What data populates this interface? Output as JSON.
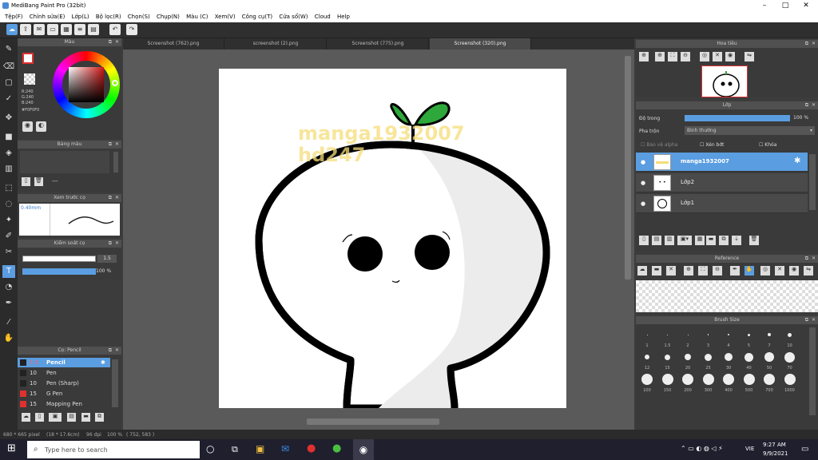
{
  "window": {
    "title": "MediBang Paint Pro (32bit)"
  },
  "menu": [
    "Tệp(F)",
    "Chỉnh sửa(E)",
    "Lớp(L)",
    "Bộ lọc(R)",
    "Chọn(S)",
    "Chụp(N)",
    "Màu (C)",
    "Xem(V)",
    "Công cụ(T)",
    "Cửa sổ(W)",
    "Cloud",
    "Help"
  ],
  "tabs": [
    "Screenshot (762).png",
    "screenshot (2).png",
    "Screenshot (775).png",
    "Screenshot (320).png"
  ],
  "color_panel": {
    "title": "Màu",
    "r": "R:240",
    "g": "G:240",
    "b": "B:240",
    "hex": "#F0F0F0"
  },
  "palette_panel": {
    "title": "Bảng màu",
    "dash": "---"
  },
  "preview_panel": {
    "title": "Xem trước cọ",
    "size": "0.40mm"
  },
  "control_panel": {
    "title": "Kiểm soát cọ",
    "size_val": "1.5",
    "opacity_val": "100 %"
  },
  "brush_panel": {
    "title": "Cọ: Pencil",
    "items": [
      {
        "size": "1.5",
        "name": "Pencil",
        "color": "#222222",
        "selected": true
      },
      {
        "size": "10",
        "name": "Pen",
        "color": "#222222",
        "selected": false
      },
      {
        "size": "10",
        "name": "Pen (Sharp)",
        "color": "#222222",
        "selected": false
      },
      {
        "size": "15",
        "name": "G Pen",
        "color": "#e03030",
        "selected": false
      },
      {
        "size": "15",
        "name": "Mapping Pen",
        "color": "#e03030",
        "selected": false
      }
    ]
  },
  "navigator": {
    "title": "Hoa tiêu"
  },
  "layer_panel": {
    "title": "Lớp",
    "opacity_label": "Độ trong",
    "opacity_val": "100 %",
    "blend_label": "Pha trộn",
    "blend_val": "Bình thường",
    "protect_alpha": "Bảo vệ alpha",
    "clipping": "Xén bớt",
    "lock": "Khóa",
    "layers": [
      {
        "name": "manga1932007",
        "selected": true
      },
      {
        "name": "Lớp2",
        "selected": false
      },
      {
        "name": "Lớp1",
        "selected": false
      }
    ]
  },
  "reference": {
    "title": "Reference"
  },
  "brush_size": {
    "title": "Brush Size",
    "sizes": [
      "1",
      "1.5",
      "2",
      "3",
      "4",
      "5",
      "7",
      "10",
      "12",
      "15",
      "20",
      "25",
      "30",
      "40",
      "50",
      "70",
      "100",
      "150",
      "200",
      "300",
      "400",
      "500",
      "700",
      "1000"
    ]
  },
  "watermark": {
    "line1": "manga1932007",
    "line2": "hd247"
  },
  "status": {
    "dims": "680 * 665 pixel",
    "cm": "(18 * 17.6cm)",
    "dpi": "96 dpi",
    "zoom": "100 %",
    "coords": "( 752, 583 )"
  },
  "taskbar": {
    "search_placeholder": "Type here to search",
    "time": "9:27 AM",
    "date": "9/9/2021",
    "lang": "VIE"
  },
  "colors": {
    "accent": "#5a9de0",
    "panel": "#3a3a3a",
    "sprout": "#2ea83a"
  }
}
